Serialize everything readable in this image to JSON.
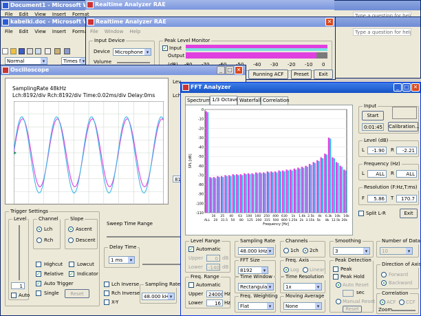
{
  "word1": {
    "title": "Document1 - Microsoft Word",
    "menu": [
      "File",
      "Edit",
      "View",
      "Insert",
      "Format"
    ],
    "help_placeholder": "Type a question for help"
  },
  "word2": {
    "title": "kabelki.doc - Microsoft Word",
    "menu": [
      "File",
      "Edit",
      "View",
      "Insert",
      "Format"
    ],
    "style": "Normal",
    "font": "Times New",
    "help_placeholder": "Type a question for help"
  },
  "rae_back": {
    "title": "Realtime Analyzer RAE"
  },
  "rae": {
    "title": "Realtime Analyzer RAE",
    "menu": [
      "File",
      "Window",
      "Help"
    ],
    "input_device": {
      "group": "Input Device",
      "device_label": "Device",
      "device_value": "Microphone",
      "volume_label": "Volume"
    },
    "peak": {
      "group": "Peak Level Monitor",
      "input_label": "Input",
      "output_label": "Output",
      "db_label": "(dB)",
      "scale": [
        "-80",
        "-70",
        "-60",
        "-50",
        "-40",
        "-30",
        "-20",
        "-10",
        "0"
      ]
    },
    "buttons": {
      "running": "Running ACF",
      "preset": "Preset",
      "exit": "Exit"
    }
  },
  "osc": {
    "title": "Oscilloscope",
    "info1": "SamplingRate 48kHz",
    "info2": "Lch:8192/div  Rch:8192/div  Time:0.02ms/div  Delay:0ms",
    "behind": {
      "lev": "Lev",
      "lch": "Lch",
      "val819": "819"
    },
    "trigger": {
      "group": "Trigger Settings",
      "level": "Level",
      "level_value": "1",
      "auto": "Auto",
      "channel": "Channel",
      "lch": "Lch",
      "rch": "Rch",
      "slope": "Slope",
      "ascent": "Ascent",
      "descent": "Descent",
      "highcut": "Highcut",
      "lowcut": "Lowcut",
      "relative": "Relative",
      "indicator": "Indicator",
      "auto_trigger": "Auto Trigger",
      "single": "Single",
      "reset": "Reset"
    },
    "sweep": {
      "group": "Sweep Time Range",
      "delay_group": "Delay Time",
      "delay_value": "1 ms",
      "lch_inverse": "Lch Inverse",
      "rch_inverse": "Rch Inverse",
      "xy": "X-Y",
      "sampling_group": "Sampling Rate",
      "sampling_value": "48.000 kHz"
    }
  },
  "fft": {
    "title": "FFT Analyzer",
    "tabs": [
      "Spectrum",
      "1/3 Octave",
      "Waterfall",
      "Correlation"
    ],
    "plot": {
      "ylabel": "SPL [dB]",
      "xlabel": "Frequency [Hz]"
    },
    "input": {
      "group": "Input",
      "start": "Start",
      "time": "0:01:45",
      "calibration": "Calibration..."
    },
    "level": {
      "group": "Level (dB)",
      "l": "L",
      "l_value": "-1.90",
      "r": "R",
      "r_value": "-2.21"
    },
    "frequency": {
      "group": "Frequency (Hz)",
      "l": "L",
      "l_value": "ALL",
      "r": "R",
      "r_value": "ALL"
    },
    "resolution": {
      "group": "Resolution (F:Hz,T:ms)",
      "f": "F",
      "f_value": "5.86",
      "t": "T",
      "t_value": "170.7"
    },
    "split": "Split L-R",
    "exit": "Exit",
    "level_range": {
      "group": "Level Range",
      "automatic": "Automatic",
      "upper": "Upper",
      "upper_value": "0",
      "lower": "Lower",
      "lower_value": "-140",
      "unit": "dB"
    },
    "freq_range": {
      "group": "Freq. Range",
      "automatic": "Automatic",
      "upper": "Upper",
      "upper_value": "24000",
      "lower": "Lower",
      "lower_value": "16",
      "unit": "Hz"
    },
    "sampling": {
      "group": "Sampling Rate",
      "value": "48.000 kHz"
    },
    "fft_size": {
      "group": "FFT Size",
      "value": "8192"
    },
    "time_window": {
      "group": "Time Window",
      "value": "Rectangular"
    },
    "freq_weighting": {
      "group": "Freq. Weighting",
      "value": "Flat"
    },
    "channels": {
      "group": "Channels",
      "ch1": "1ch",
      "ch2": "2ch"
    },
    "freq_axis": {
      "group": "Freq. Axis",
      "log": "Log",
      "linear": "Linear"
    },
    "time_resolution": {
      "group": "Time Resolution",
      "value": "1x"
    },
    "moving_average": {
      "group": "Moving Average",
      "value": "None"
    },
    "smoothing": {
      "group": "Smoothing",
      "value": "3"
    },
    "peak_detection": {
      "group": "Peak Detection",
      "peak": "Peak",
      "peak_hold": "Peak Hold",
      "auto_reset": "Auto Reset",
      "sec": "sec",
      "manual_reset": "Manual Reset",
      "reset": "Reset"
    },
    "num_data": {
      "group": "Number of Data",
      "value": "10"
    },
    "direction": {
      "group": "Direction of Axis",
      "forward": "Forward",
      "backward": "Backward"
    },
    "correlation": {
      "group": "Correlation",
      "acf": "ACF",
      "ccf": "CCF",
      "zoom": "Zoom"
    }
  },
  "chart_data": [
    {
      "type": "line",
      "series": [
        {
          "color": "#e040e0"
        },
        {
          "color": "#40b8e8"
        }
      ],
      "cycles": 4.3,
      "grid": true
    },
    {
      "type": "bar",
      "ylim": [
        -110,
        0
      ],
      "yticks": [
        "0",
        "-10",
        "-20",
        "-30",
        "-40",
        "-50",
        "-60",
        "-70",
        "-80",
        "-90",
        "-100",
        "-110"
      ],
      "xticks": [
        "16",
        "25",
        "40",
        "63",
        "100",
        "160",
        "250",
        "400",
        "630",
        "1k",
        "1.6k",
        "2.5k",
        "4k",
        "6.3k",
        "10k",
        "16k"
      ],
      "xticks2": [
        "ALL",
        "20",
        "31.5",
        "50",
        "80",
        "125",
        "200",
        "315",
        "500",
        "800",
        "1.25k",
        "2k",
        "3.15k",
        "5k",
        "8k",
        "12.5k",
        "20k"
      ],
      "series": [
        {
          "color": "#e040e0",
          "values": [
            -2,
            -72,
            -72,
            -71,
            -71,
            -70,
            -70,
            -69,
            -69,
            -69,
            -68,
            -68,
            -68,
            -67,
            -67,
            -67,
            -66,
            -66,
            -66,
            -65,
            -65,
            -64,
            -64,
            -63,
            -62,
            -61,
            -60,
            -58,
            -56,
            -54,
            -51,
            -47,
            -30,
            -51,
            -56,
            -60,
            -64
          ]
        },
        {
          "color": "#40b8e8",
          "values": [
            -3,
            -73,
            -73,
            -72,
            -72,
            -71,
            -71,
            -70,
            -70,
            -70,
            -69,
            -69,
            -69,
            -68,
            -68,
            -68,
            -67,
            -67,
            -67,
            -66,
            -66,
            -65,
            -65,
            -64,
            -63,
            -62,
            -61,
            -59,
            -57,
            -55,
            -52,
            -48,
            -31,
            -52,
            -57,
            -61,
            -65
          ]
        }
      ]
    }
  ]
}
